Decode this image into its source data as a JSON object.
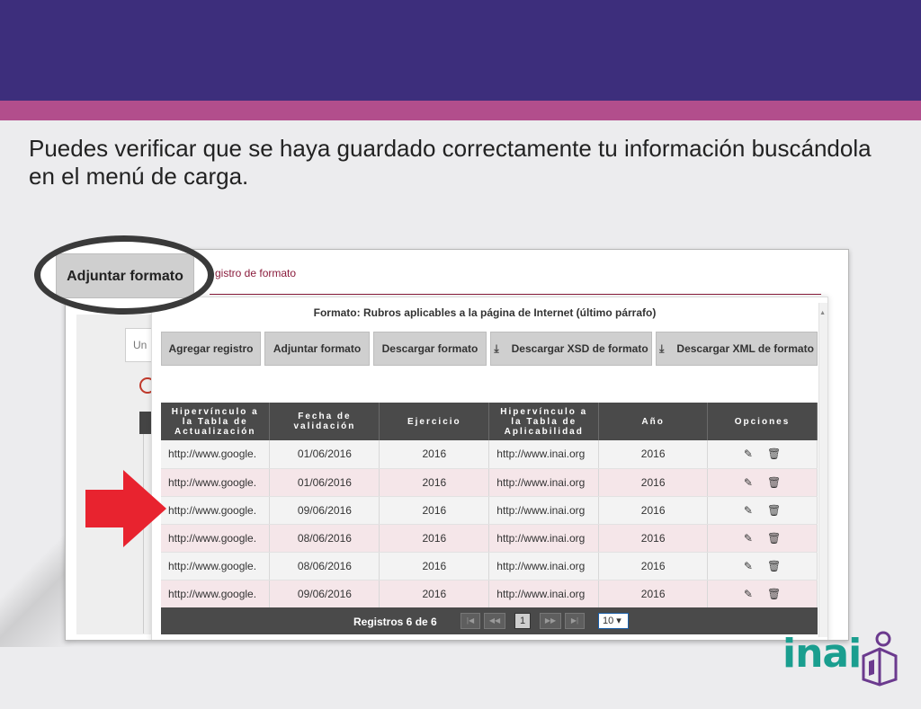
{
  "slide": {
    "headline": "Puedes verificar que se haya guardado correctamente tu información buscándola en el menú de carga."
  },
  "screenshot": {
    "title": "gistro de formato",
    "background_input_text": "Un"
  },
  "modal": {
    "title": "Formato: Rubros aplicables a la página de Internet (último párrafo)",
    "buttons": {
      "add_record": "Agregar registro",
      "attach_format": "Adjuntar formato",
      "download_format": "Descargar formato",
      "download_xsd": "Descargar XSD de formato",
      "download_xml": "Descargar XML de formato"
    },
    "table": {
      "headers": [
        "Hipervínculo a la Tabla de Actualización",
        "Fecha de validación",
        "Ejercicio",
        "Hipervínculo a la Tabla de Aplicabilidad",
        "Año",
        "Opciones"
      ],
      "rows": [
        [
          "http://www.google.",
          "01/06/2016",
          "2016",
          "http://www.inai.org",
          "2016"
        ],
        [
          "http://www.google.",
          "01/06/2016",
          "2016",
          "http://www.inai.org",
          "2016"
        ],
        [
          "http://www.google.",
          "09/06/2016",
          "2016",
          "http://www.inai.org",
          "2016"
        ],
        [
          "http://www.google.",
          "08/06/2016",
          "2016",
          "http://www.inai.org",
          "2016"
        ],
        [
          "http://www.google.",
          "08/06/2016",
          "2016",
          "http://www.inai.org",
          "2016"
        ],
        [
          "http://www.google.",
          "09/06/2016",
          "2016",
          "http://www.inai.org",
          "2016"
        ]
      ]
    },
    "pager": {
      "summary": "Registros 6 de 6",
      "first": "|◀",
      "prev": "◀◀",
      "current_page": "1",
      "next": "▶▶",
      "last": "▶|",
      "page_size": "10 ▾"
    }
  },
  "callout": {
    "label": "Adjuntar formato"
  },
  "logo": {
    "text": "inai"
  },
  "icons": {
    "edit": "✎",
    "delete": "🗑",
    "download": "⤓"
  },
  "colors": {
    "top_band": "#3d2e7c",
    "pink_band": "#b24e8c",
    "accent_red": "#e8232f",
    "logo_teal": "#1a9e8f",
    "logo_purple": "#6b3a8e"
  }
}
